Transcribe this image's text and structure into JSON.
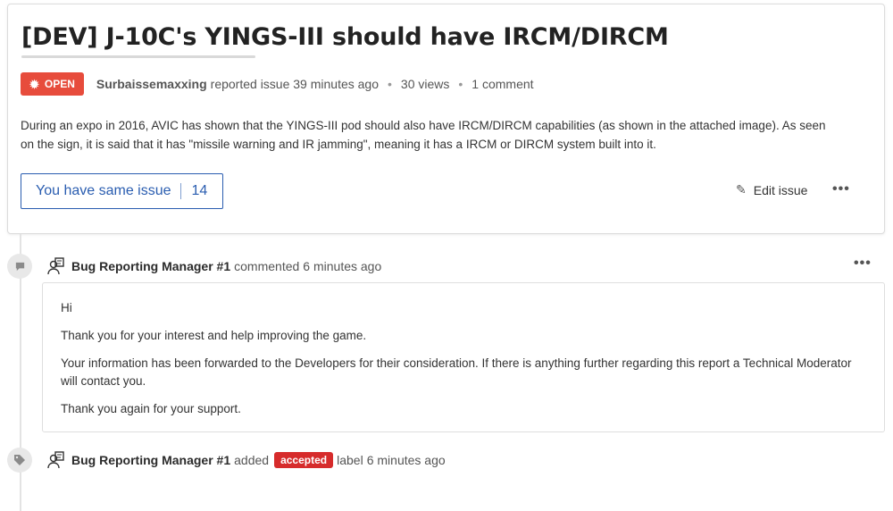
{
  "issue": {
    "title": "[DEV] J-10C's YINGS-III should have IRCM/DIRCM",
    "status": "OPEN",
    "author": "Surbaissemaxxing",
    "reported_text": "reported issue 39 minutes ago",
    "views": "30 views",
    "comments": "1 comment",
    "description": "During an expo in 2016, AVIC has shown that the YINGS-III pod should also have IRCM/DIRCM capabilities (as shown in the attached image). As seen on the sign, it is said that it has \"missile warning and IR jamming\", meaning it has a IRCM or DIRCM system built into it.",
    "same_issue_label": "You have same issue",
    "same_issue_count": "14",
    "edit_label": "Edit issue",
    "more_label": "•••"
  },
  "comment": {
    "author": "Bug Reporting Manager #1",
    "action": "commented",
    "time": "6 minutes ago",
    "more_label": "•••",
    "paragraphs": [
      "Hi",
      "Thank you for your interest and help improving the game.",
      "Your information has been forwarded to the Developers for their consideration. If there is anything further regarding this report a Technical Moderator will contact you.",
      "Thank you again for your support."
    ]
  },
  "label_event": {
    "author": "Bug Reporting Manager #1",
    "action": "added",
    "label": "accepted",
    "suffix": "label",
    "time": "6 minutes ago"
  },
  "colors": {
    "open_badge": "#e74c3c",
    "accepted_badge": "#d62b2b",
    "link_blue": "#2a5db0"
  }
}
